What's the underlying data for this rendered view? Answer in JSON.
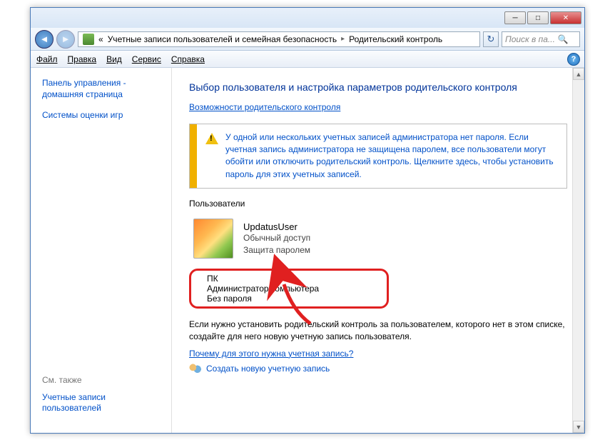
{
  "breadcrumb": {
    "prefix": "«",
    "part1": "Учетные записи пользователей и семейная безопасность",
    "part2": "Родительский контроль"
  },
  "search": {
    "placeholder": "Поиск в па..."
  },
  "menu": {
    "file": "Файл",
    "edit": "Правка",
    "view": "Вид",
    "tools": "Сервис",
    "help": "Справка"
  },
  "sidebar": {
    "home": "Панель управления - домашняя страница",
    "ratings": "Системы оценки игр",
    "seealso_label": "См. также",
    "accounts": "Учетные записи пользователей"
  },
  "main": {
    "title": "Выбор пользователя и настройка параметров родительского контроля",
    "sublink": "Возможности родительского контроля",
    "warning": "У одной или нескольких учетных записей администратора нет пароля. Если учетная запись администратора не защищена паролем, все пользователи могут обойти или отключить родительский контроль. Щелкните здесь, чтобы установить пароль для этих учетных записей.",
    "users_label": "Пользователи",
    "users": [
      {
        "name": "UpdatusUser",
        "line1": "Обычный доступ",
        "line2": "Защита паролем"
      },
      {
        "name": "ПК",
        "line1": "Администратор компьютера",
        "line2": "Без пароля"
      }
    ],
    "note": "Если нужно установить родительский контроль за пользователем, которого нет в этом списке, создайте для него новую учетную запись пользователя.",
    "why_link": "Почему для этого нужна учетная запись?",
    "create_link": "Создать новую учетную запись"
  }
}
